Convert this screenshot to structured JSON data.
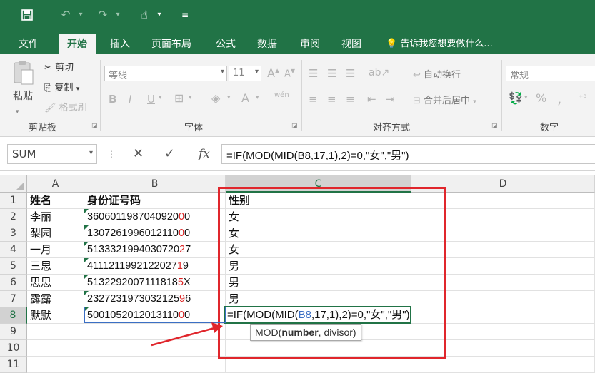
{
  "qat": {
    "save_icon": "save-icon",
    "undo_icon": "undo-icon",
    "redo_icon": "redo-icon",
    "touch_icon": "touch-mode-icon",
    "customize_icon": "customize-qat-icon"
  },
  "tabs": [
    "文件",
    "开始",
    "插入",
    "页面布局",
    "公式",
    "数据",
    "审阅",
    "视图"
  ],
  "tell_me": "告诉我您想要做什么...",
  "clipboard": {
    "paste": "粘贴",
    "cut": "剪切",
    "copy": "复制",
    "format_painter": "格式刷",
    "label": "剪贴板"
  },
  "font": {
    "name": "等线",
    "size": "11",
    "label": "字体",
    "bold": "B",
    "italic": "I",
    "underline": "U",
    "grow": "A",
    "shrink": "A",
    "phonetic": "wén"
  },
  "alignment": {
    "wrap": "自动换行",
    "merge": "合并后居中",
    "label": "对齐方式"
  },
  "number": {
    "format": "常规",
    "label": "数字",
    "percent": "%",
    "comma": ","
  },
  "formula_bar": {
    "name_box": "SUM",
    "cancel": "✕",
    "enter": "✓",
    "fx": "fx",
    "formula": "=IF(MOD(MID(B8,17,1),2)=0,\"女\",\"男\")"
  },
  "columns": [
    "A",
    "B",
    "C",
    "D"
  ],
  "rows": [
    "1",
    "2",
    "3",
    "4",
    "5",
    "6",
    "7",
    "8",
    "9",
    "10",
    "11"
  ],
  "header_row": {
    "a": "姓名",
    "b": "身份证号码",
    "c": "性别"
  },
  "data_rows": [
    {
      "a": "李丽",
      "b_head": "3606011987040920",
      "b_red": "0",
      "b_tail": "0",
      "c": "女"
    },
    {
      "a": "梨园",
      "b_head": "1307261996012110",
      "b_red": "0",
      "b_tail": "0",
      "c": "女"
    },
    {
      "a": "一月",
      "b_head": "5133321994030720",
      "b_red": "2",
      "b_tail": "7",
      "c": "女"
    },
    {
      "a": "三思",
      "b_head": "4111211992122027",
      "b_red": "1",
      "b_tail": "9",
      "c": "男"
    },
    {
      "a": "思思",
      "b_head": "5132292007111818",
      "b_red": "5",
      "b_tail": "X",
      "c": "男"
    },
    {
      "a": "露露",
      "b_head": "2327231973032125",
      "b_red": "9",
      "b_tail": "6",
      "c": "男"
    },
    {
      "a": "默默",
      "b_head": "5001052012013110",
      "b_red": "0",
      "b_tail": "0",
      "c": ""
    }
  ],
  "editing": {
    "pre": "=IF(MOD(MID(",
    "ref": "B8",
    "post": ",17,1),2)=0,\"女\",\"男\")"
  },
  "tooltip": {
    "fn": "MOD(",
    "arg1": "number",
    "rest": ", divisor)"
  },
  "colors": {
    "excel_green": "#217346",
    "annotation_red": "#e0262c",
    "ref_blue": "#3b6fc4"
  }
}
